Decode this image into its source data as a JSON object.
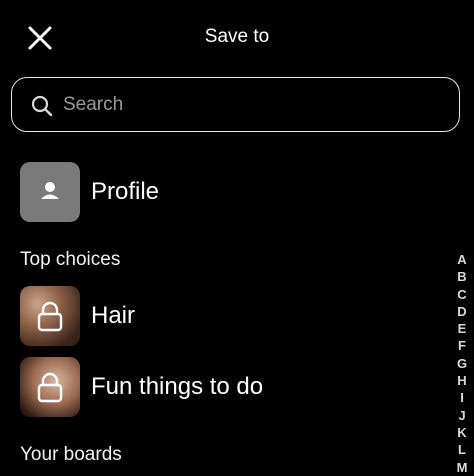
{
  "header": {
    "title": "Save to"
  },
  "search": {
    "placeholder": "Search",
    "value": ""
  },
  "profile": {
    "label": "Profile"
  },
  "top_choices": {
    "heading": "Top choices",
    "boards": [
      {
        "label": "Hair",
        "icon": "lock-icon"
      },
      {
        "label": "Fun things to do",
        "icon": "lock-icon"
      }
    ]
  },
  "your_boards": {
    "heading": "Your boards"
  },
  "alphabet_index": [
    "A",
    "B",
    "C",
    "D",
    "E",
    "F",
    "G",
    "H",
    "I",
    "J",
    "K",
    "L",
    "M"
  ],
  "colors": {
    "background": "#000000",
    "search_border": "#e6e6e6",
    "profile_tile": "#7a7a7a"
  }
}
